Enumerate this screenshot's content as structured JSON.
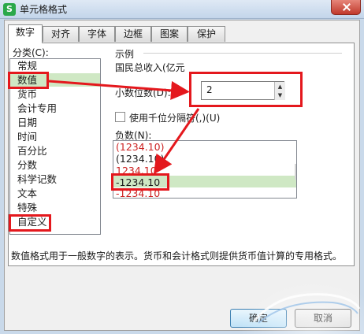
{
  "window": {
    "app_icon": "S",
    "title": "单元格格式"
  },
  "tabs": [
    {
      "label": "数字",
      "active": true
    },
    {
      "label": "对齐"
    },
    {
      "label": "字体"
    },
    {
      "label": "边框"
    },
    {
      "label": "图案"
    },
    {
      "label": "保护"
    }
  ],
  "category": {
    "label": "分类(C):",
    "items": [
      "常规",
      "数值",
      "货币",
      "会计专用",
      "日期",
      "时间",
      "百分比",
      "分数",
      "科学记数",
      "文本",
      "特殊",
      "自定义"
    ],
    "selected": "数值"
  },
  "sample": {
    "label": "示例",
    "value": "国民总收入(亿元"
  },
  "decimal": {
    "label": "小数位数(D):",
    "value": "2"
  },
  "separator": {
    "label": "使用千位分隔符(,)(U)",
    "checked": false
  },
  "negative": {
    "label": "负数(N):",
    "items": [
      {
        "text": "(1234.10)",
        "color": "#cc2222"
      },
      {
        "text": "(1234.10)",
        "color": "#1a1a1a"
      },
      {
        "text": "1234.10",
        "color": "#cc2222"
      },
      {
        "text": "-1234.10",
        "color": "#1a1a1a"
      },
      {
        "text": "-1234.10",
        "color": "#cc2222"
      }
    ],
    "selected": "-1234.10"
  },
  "description": "数值格式用于一般数字的表示。货币和会计格式则提供货币值计算的专用格式。",
  "buttons": {
    "ok": "确定",
    "cancel": "取消"
  },
  "colors": {
    "annotation_red": "#e4181d",
    "selection": "#cfe8c4",
    "negative_red": "#cc2222"
  }
}
